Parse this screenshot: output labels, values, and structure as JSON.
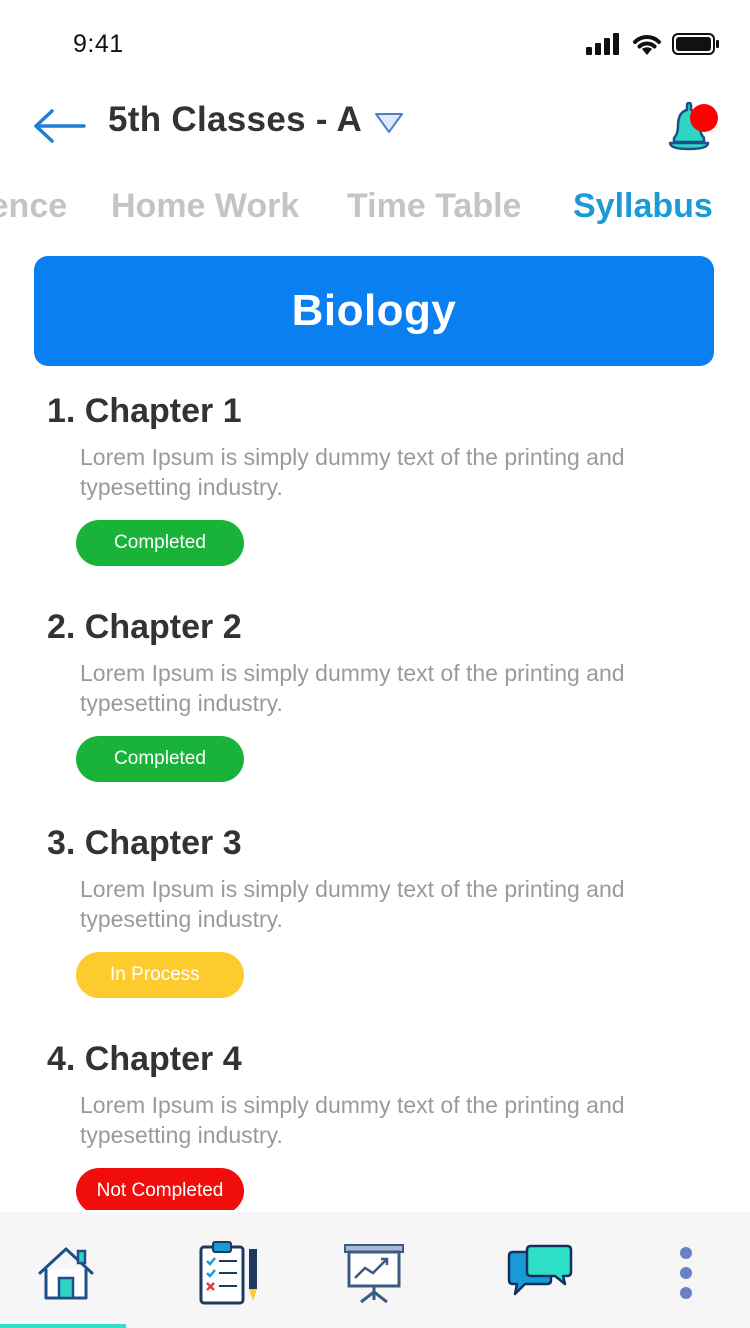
{
  "status_bar": {
    "time": "9:41"
  },
  "header": {
    "class_title": "5th Classes - A"
  },
  "tabs": [
    {
      "label": "Attendence",
      "active": false
    },
    {
      "label": "Home Work",
      "active": false
    },
    {
      "label": "Time Table",
      "active": false
    },
    {
      "label": "Syllabus",
      "active": true
    }
  ],
  "subject": {
    "title": "Biology",
    "color": "#0a7ff2"
  },
  "chapters": [
    {
      "title": "1. Chapter 1",
      "description": "Lorem Ipsum is simply dummy text of the printing and typesetting industry.",
      "status": "Completed",
      "status_color": "#19b33a"
    },
    {
      "title": "2. Chapter 2",
      "description": "Lorem Ipsum is simply dummy text of the printing and typesetting industry.",
      "status": "Completed",
      "status_color": "#19b33a"
    },
    {
      "title": "3. Chapter 3",
      "description": "Lorem Ipsum is simply dummy text of the printing and typesetting industry.",
      "status": "In Process",
      "status_color": "#fecb2f"
    },
    {
      "title": "4. Chapter 4",
      "description": "Lorem Ipsum is simply dummy text of the printing and typesetting industry.",
      "status": "Not Completed",
      "status_color": "#f20d0d"
    }
  ],
  "bottom_nav": [
    {
      "icon": "home-icon",
      "active": true
    },
    {
      "icon": "clipboard-icon",
      "active": false
    },
    {
      "icon": "presentation-chart-icon",
      "active": false
    },
    {
      "icon": "chat-icon",
      "active": false
    },
    {
      "icon": "more-vertical-icon",
      "active": false
    }
  ],
  "colors": {
    "accent": "#1a9ad6",
    "tab_inactive": "#c4c4c4",
    "nav_indicator": "#2ee0c8",
    "notification_dot": "#ff0000"
  }
}
